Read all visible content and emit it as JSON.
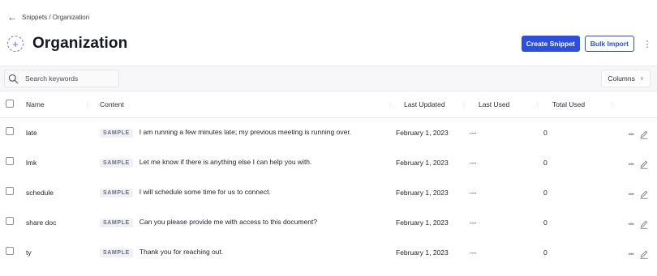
{
  "breadcrumb": {
    "back_icon": "arrow-left-icon",
    "path": "Snippets / Organization"
  },
  "header": {
    "icon": "plus-circle-dashed-icon",
    "title": "Organization",
    "create_label": "Create Snippet",
    "import_label": "Bulk Import",
    "more_icon": "kebab-vertical-icon",
    "accent_color": "#2b4fe0"
  },
  "toolbar": {
    "search_placeholder": "Search keywords",
    "columns_label": "Columns"
  },
  "table": {
    "columns": [
      "Name",
      "Content",
      "Last Updated",
      "Last Used",
      "Total Used"
    ],
    "badge_label": "SAMPLE",
    "rows": [
      {
        "name": "late",
        "content": "I am running a few minutes late; my previous meeting is running over.",
        "last_updated": "February 1, 2023",
        "last_used": "---",
        "total_used": "0"
      },
      {
        "name": "lmk",
        "content": "Let me know if there is anything else I can help you with.",
        "last_updated": "February 1, 2023",
        "last_used": "---",
        "total_used": "0"
      },
      {
        "name": "schedule",
        "content": "I will schedule some time for us to connect.",
        "last_updated": "February 1, 2023",
        "last_used": "---",
        "total_used": "0"
      },
      {
        "name": "share doc",
        "content": "Can you please provide me with access to this document?",
        "last_updated": "February 1, 2023",
        "last_used": "---",
        "total_used": "0"
      },
      {
        "name": "ty",
        "content": "Thank you for reaching out.",
        "last_updated": "February 1, 2023",
        "last_used": "---",
        "total_used": "0"
      }
    ]
  }
}
